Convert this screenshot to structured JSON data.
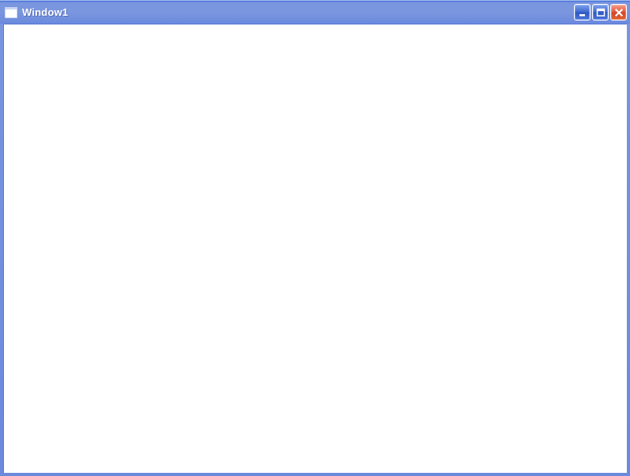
{
  "window": {
    "title": "Window1"
  }
}
